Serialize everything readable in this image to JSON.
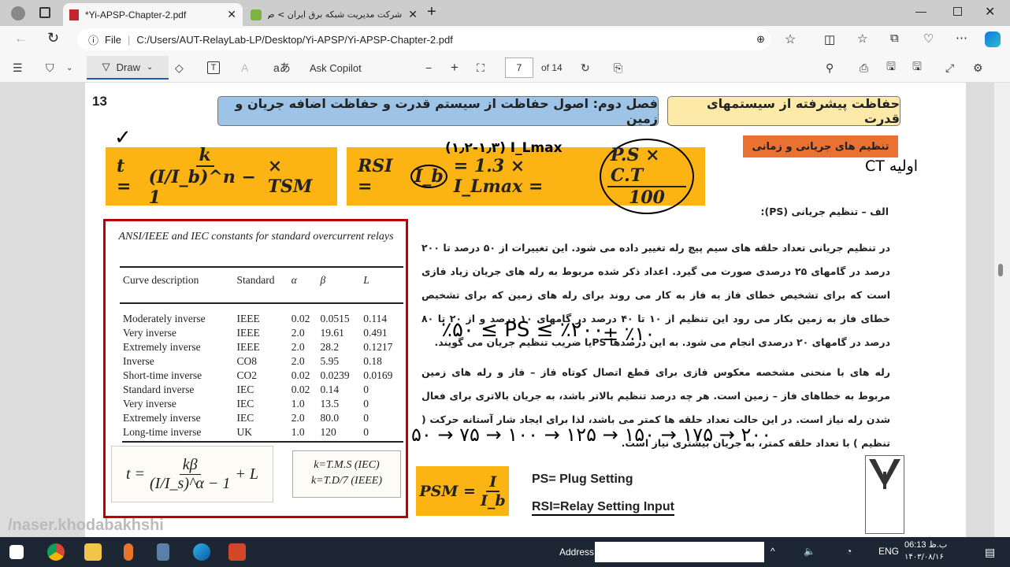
{
  "browser": {
    "tabs": [
      {
        "title": "*Yi-APSP-Chapter-2.pdf",
        "active": true
      },
      {
        "title": "شرکت مدیریت شبکه برق ایران > ص",
        "active": false
      }
    ],
    "address": {
      "scheme_label": "File",
      "url": "C:/Users/AUT-RelayLab-LP/Desktop/Yi-APSP/Yi-APSP-Chapter-2.pdf"
    }
  },
  "pdf_toolbar": {
    "draw_label": "Draw",
    "copilot_label": "Ask Copilot",
    "page_current": "7",
    "page_total": "of 14"
  },
  "page": {
    "page_number": "13",
    "header_course": "حفاظت پیشرفته از سیستمهای قدرت",
    "header_chapter": "فصل دوم: اصول حفاظت از سیستم قدرت و حفاظت اضافه جریان و زمین",
    "subheader": "تنظیم های جریانی و زمانی",
    "formula1": {
      "lhs": "t =",
      "num": "k",
      "den": "(I/I_b)^n − 1",
      "tail": "× TSM"
    },
    "formula2": {
      "lhs": "RSI =",
      "ib": "I_b",
      "mid": "= 1.3 × I_Lmax =",
      "num": "P.S × C.T",
      "den": "100"
    },
    "section_title": "الف – تنظیم جریانی (PS):",
    "table": {
      "caption": "ANSI/IEEE and IEC constants for standard overcurrent relays",
      "headers": [
        "Curve description",
        "Standard",
        "α",
        "β",
        "L"
      ],
      "rows": [
        [
          "Moderately inverse",
          "IEEE",
          "0.02",
          "0.0515",
          "0.114"
        ],
        [
          "Very inverse",
          "IEEE",
          "2.0",
          "19.61",
          "0.491"
        ],
        [
          "Extremely inverse",
          "IEEE",
          "2.0",
          "28.2",
          "0.1217"
        ],
        [
          "Inverse",
          "CO8",
          "2.0",
          "5.95",
          "0.18"
        ],
        [
          "Short-time inverse",
          "CO2",
          "0.02",
          "0.0239",
          "0.0169"
        ],
        [
          "Standard inverse",
          "IEC",
          "0.02",
          "0.14",
          "0"
        ],
        [
          "Very inverse",
          "IEC",
          "1.0",
          "13.5",
          "0"
        ],
        [
          "Extremely inverse",
          "IEC",
          "2.0",
          "80.0",
          "0"
        ],
        [
          "Long-time inverse",
          "UK",
          "1.0",
          "120",
          "0"
        ]
      ]
    },
    "eq_general": {
      "lhs": "t =",
      "num": "kβ",
      "den": "(I/I_s)^α − 1",
      "tail": "+ L"
    },
    "k_defs": [
      "k=T.M.S (IEC)",
      "k=T.D/7 (IEEE)"
    ],
    "paragraph1": "در تنظیم جریانی تعداد حلقه های سیم پیچ رله تغییر داده می شود. این تغییرات از ۵۰ درصد تا ۲۰۰ درصد در گامهای ۲۵ درصدی صورت می گیرد. اعداد ذکر شده مربوط به رله های جریان زیاد فازی است که برای تشخیص خطای فاز به فاز به کار می روند برای رله های زمین که برای تشخیص خطای فاز به زمین بکار می رود این تنظیم از ۱۰ تا ۴۰ درصد در گامهای ۱۰ درصد و از ۲۰ تا ۸۰ درصد در گامهای ۲۰ درصدی انجام می شود. به این درصدها PSیا ضریب تنظیم جریان می گویند.",
    "paragraph2": "رله های با منحنی مشخصه معکوس فازی برای قطع اتصال کوتاه فاز – فاز و رله های زمین مربوط به خطاهای فاز – زمین است. هر چه درصد تنظیم بالاتر باشد، به جریان بالاتری برای فعال شدن رله نیاز است. در این حالت تعداد حلقه ها کمتر می باشد، لذا برای ایجاد شار آستانه حرکت ( تنظیم ) با تعداد حلقه کمتر، به جریان بیشتری نیاز است.",
    "psm": {
      "lhs": "PSM =",
      "num": "I",
      "den": "I_b"
    },
    "def_ps": "PS= Plug Setting",
    "def_rsi": "RSI=Relay Setting Input",
    "annotations": {
      "range": "٪۵۰ ≤ PS ≤ ٪۲۰۰",
      "tol": "± ٪۱۰",
      "steps": "۵۰ → ۷۵ → ۱۰۰ → ۱۲۵ → ۱۵۰ → ۱۷۵ → ۲۰۰",
      "factor": "(۱٫۲-۱٫۳) I_Lmax",
      "ct": "اولیه CT",
      "check": "✓"
    },
    "watermark": "/naser.khodabakhshi"
  },
  "taskbar": {
    "address_label": "Address",
    "lang": "ENG",
    "time": "06:13 ب.ظ",
    "date": "۱۴۰۳/۰۸/۱۶"
  }
}
